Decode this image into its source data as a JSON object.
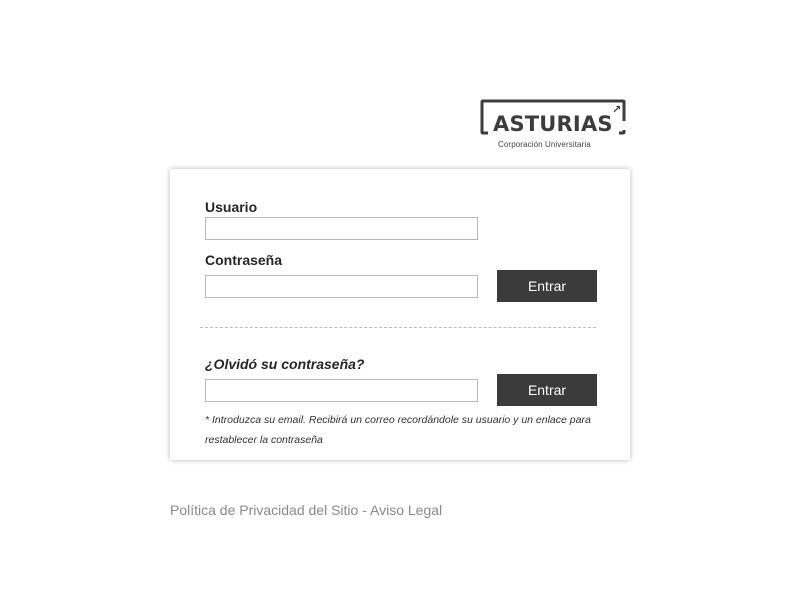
{
  "logo": {
    "word": "ASTURIAS",
    "arrow": "↗",
    "subtitle": "Corporación Universitaria",
    "color": "#3c3c3c"
  },
  "login": {
    "username_label": "Usuario",
    "username_value": "",
    "password_label": "Contraseña",
    "password_value": "",
    "submit_label": "Entrar"
  },
  "recovery": {
    "title": "¿Olvidó su contraseña?",
    "email_value": "",
    "submit_label": "Entrar",
    "note": "* Introduzca su email. Recibirá un correo recordándole su usuario y un enlace para restablecer la contraseña"
  },
  "footer": {
    "privacy_link": "Política de Privacidad del Sitio",
    "separator": " - ",
    "legal_link": "Aviso Legal"
  },
  "colors": {
    "button_bg": "#3b3b3b",
    "footer_text": "#8a8a8a"
  }
}
